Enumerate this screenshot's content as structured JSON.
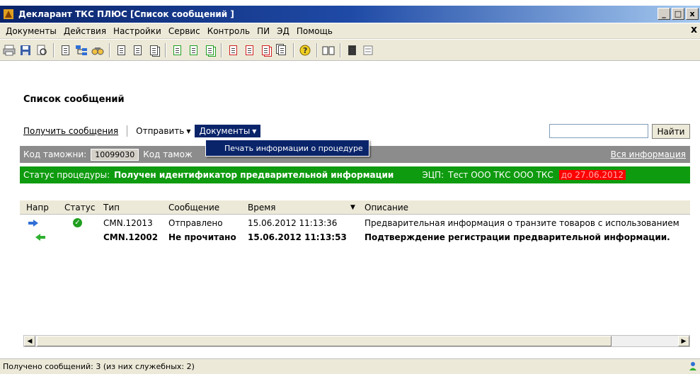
{
  "window": {
    "title": "Декларант ТКС ПЛЮС [Список сообщений ]",
    "minimize": "_",
    "restore": "□",
    "close": "x",
    "child_close": "x"
  },
  "menu": [
    "Документы",
    "Действия",
    "Настройки",
    "Сервис",
    "Контроль",
    "ПИ",
    "ЭД",
    "Помощь"
  ],
  "toolbar_icons": [
    "print-icon",
    "save-icon",
    "preview-icon",
    "document-add-icon",
    "tree-icon",
    "find-icon",
    "document-icon",
    "document-icon",
    "documents-icon",
    "green-document-icon",
    "green-document-icon",
    "green-documents-icon",
    "red-document-icon",
    "red-document-icon",
    "red-documents-icon",
    "copy-icon",
    "help-icon",
    "book-icon",
    "dark-document-icon",
    "form-icon"
  ],
  "page": {
    "title": "Список сообщений",
    "get_messages": "Получить сообщения",
    "send": "Отправить",
    "documents": "Документы",
    "dropdown_item": "Печать информации о процедуре",
    "search_placeholder": "",
    "search_button": "Найти"
  },
  "info1": {
    "customs_code_label": "Код таможни:",
    "customs_code_value": "10099030",
    "customs_code_label2": "Код тамож",
    "all_info": "Вся информация"
  },
  "info2": {
    "status_label": "Статус процедуры:",
    "status_value": "Получен идентификатор предварительной информации",
    "sig_label": "ЭЦП:",
    "sig_value": "Тест ООО ТКС  ООО ТКС",
    "expiry": "до 27.06.2012"
  },
  "grid": {
    "columns": [
      "Напр",
      "Статус",
      "Тип",
      "Сообщение",
      "Время",
      "Описание"
    ],
    "rows": [
      {
        "direction": "outgoing",
        "status": "ok",
        "type": "CMN.12013",
        "message": "Отправлено",
        "time": "15.06.2012 11:13:36",
        "description": "Предварительная информация о транзите товаров с использованием",
        "bold": false
      },
      {
        "direction": "incoming",
        "status": "",
        "type": "CMN.12002",
        "message": "Не прочитано",
        "time": "15.06.2012 11:13:53",
        "description": "Подтверждение регистрации предварительной информации.",
        "bold": true
      }
    ]
  },
  "statusbar": {
    "text": "Получено сообщений: 3 (из них служебных: 2)"
  },
  "colors": {
    "title_bar": "#0a246a",
    "info_gray": "#8c8c8c",
    "info_green": "#0f9b0f",
    "expiry_red": "#ff0000"
  }
}
